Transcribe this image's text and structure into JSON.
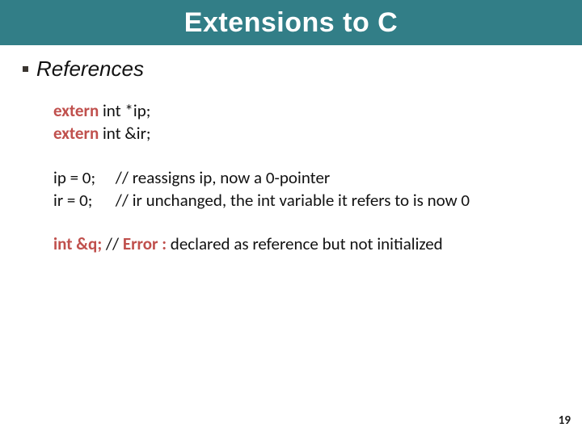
{
  "title": "Extensions to C",
  "bullet": "References",
  "decl": {
    "extern1_kw": "extern",
    "extern1_rest": " int *ip;",
    "extern2_kw": "extern",
    "extern2_rest": " int &ir;"
  },
  "assign": {
    "ip_lhs": "ip = 0;",
    "ip_cmt": "   // reassigns ip, now a 0-pointer",
    "ir_lhs": "ir = 0;",
    "ir_cmt": "   // ir unchanged, the int variable it refers to is now 0"
  },
  "err": {
    "int_kw": "int",
    "amp_kw": " &q;",
    "gap": "  // ",
    "error_kw": "Error :",
    "rest": " declared as reference but not initialized"
  },
  "page": "19"
}
